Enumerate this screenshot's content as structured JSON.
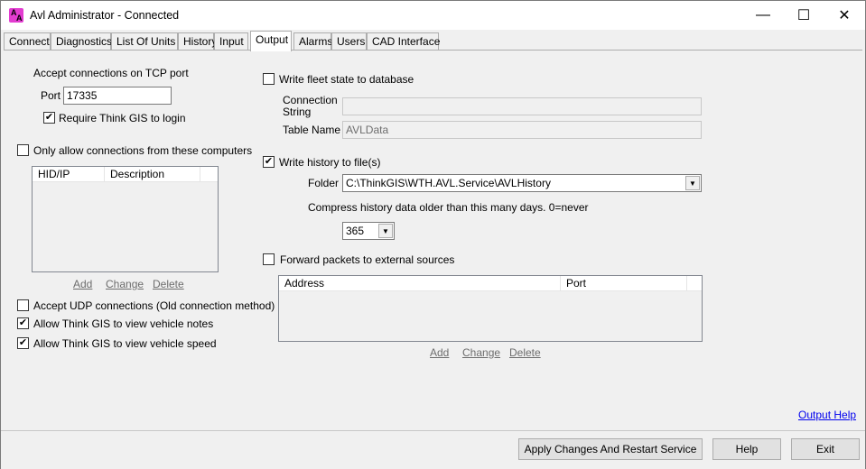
{
  "window": {
    "title": "Avl Administrator - Connected",
    "icon_letters": [
      "A",
      "A"
    ],
    "minimize_glyph": "—",
    "maximize_glyph": "☐",
    "close_glyph": "✕"
  },
  "tabs": [
    {
      "label": "Connect"
    },
    {
      "label": "Diagnostics"
    },
    {
      "label": "List Of Units"
    },
    {
      "label": "History"
    },
    {
      "label": "Input"
    },
    {
      "label": "Output",
      "active": true
    },
    {
      "label": "Alarms"
    },
    {
      "label": "Users"
    },
    {
      "label": "CAD Interface"
    }
  ],
  "left": {
    "tcp_label": "Accept connections on TCP port",
    "port_label": "Port",
    "port_value": "17335",
    "require_login_label": "Require Think GIS to login",
    "require_login_checked": "✔",
    "only_allow_label": "Only allow connections from these computers",
    "only_allow_checked": "",
    "list_columns": [
      "HID/IP",
      "Description"
    ],
    "add": "Add",
    "change": "Change",
    "delete": "Delete",
    "udp_label": "Accept UDP connections (Old connection method)",
    "udp_checked": "",
    "notes_label": "Allow Think GIS to view vehicle notes",
    "notes_checked": "✔",
    "speed_label": "Allow Think GIS to view vehicle speed",
    "speed_checked": "✔"
  },
  "right": {
    "fleet_db_label": "Write fleet state to database",
    "fleet_db_checked": "",
    "conn_string_label_1": "Connection",
    "conn_string_label_2": "String",
    "conn_string_value": "",
    "table_name_label": "Table Name",
    "table_name_value": "AVLData",
    "history_label": "Write history to file(s)",
    "history_checked": "✔",
    "folder_label": "Folder",
    "folder_value": "C:\\ThinkGIS\\WTH.AVL.Service\\AVLHistory",
    "compress_label": "Compress history data older than this many days.  0=never",
    "compress_value": "365",
    "forward_label": "Forward packets to external sources",
    "forward_checked": "",
    "list_columns": [
      "Address",
      "Port"
    ],
    "add": "Add",
    "change": "Change",
    "delete": "Delete",
    "help_link": "Output Help"
  },
  "footer": {
    "apply_label": "Apply Changes And Restart Service",
    "help_label": "Help",
    "exit_label": "Exit"
  }
}
